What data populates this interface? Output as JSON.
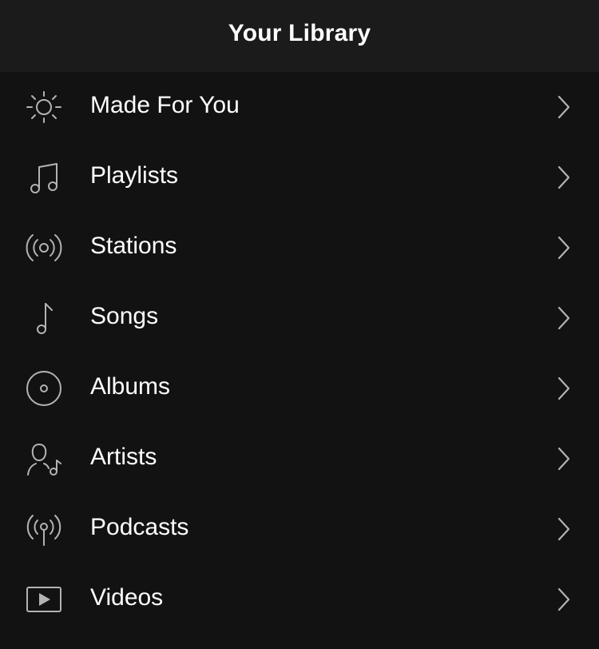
{
  "header": {
    "title": "Your Library"
  },
  "items": [
    {
      "label": "Made For You",
      "icon": "sun-icon"
    },
    {
      "label": "Playlists",
      "icon": "music-notes-icon"
    },
    {
      "label": "Stations",
      "icon": "radio-waves-icon"
    },
    {
      "label": "Songs",
      "icon": "music-note-icon"
    },
    {
      "label": "Albums",
      "icon": "album-disc-icon"
    },
    {
      "label": "Artists",
      "icon": "artist-icon"
    },
    {
      "label": "Podcasts",
      "icon": "podcast-icon"
    },
    {
      "label": "Videos",
      "icon": "video-play-icon"
    }
  ],
  "colors": {
    "background": "#121212",
    "header_background": "#1b1b1b",
    "text": "#ffffff",
    "icon": "#b3b3b3"
  }
}
